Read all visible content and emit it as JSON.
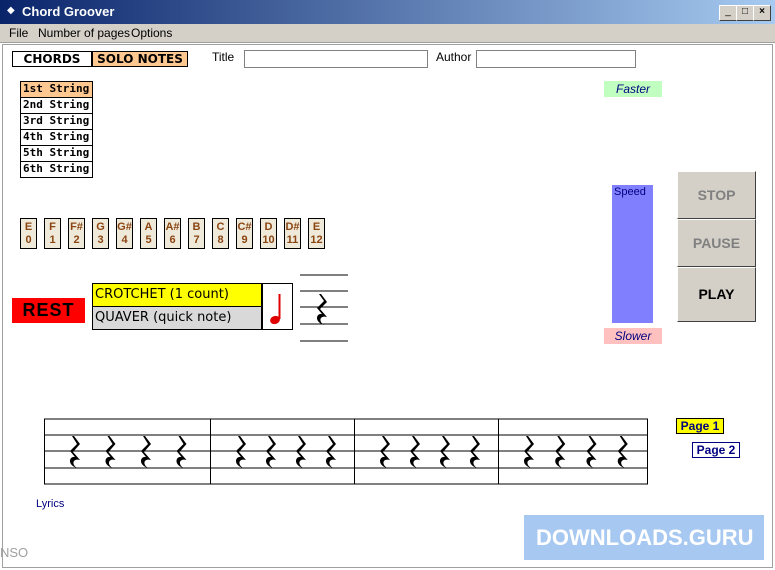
{
  "window": {
    "title": "Chord Groover",
    "app_icon": "◆",
    "minimize": "_",
    "maximize": "□",
    "close": "×"
  },
  "menu": [
    "File",
    "Number of pages",
    "Options"
  ],
  "tabs": {
    "chords": "CHORDS",
    "solo_notes": "SOLO NOTES"
  },
  "fields": {
    "title_label": "Title",
    "title_value": "",
    "author_label": "Author",
    "author_value": ""
  },
  "strings": [
    "1st String",
    "2nd String",
    "3rd String",
    "4th String",
    "5th String",
    "6th String"
  ],
  "selected_string": "1st String",
  "frets": [
    {
      "note": "E",
      "num": "0"
    },
    {
      "note": "F",
      "num": "1"
    },
    {
      "note": "F#",
      "num": "2"
    },
    {
      "note": "G",
      "num": "3"
    },
    {
      "note": "G#",
      "num": "4"
    },
    {
      "note": "A",
      "num": "5"
    },
    {
      "note": "A#",
      "num": "6"
    },
    {
      "note": "B",
      "num": "7"
    },
    {
      "note": "C",
      "num": "8"
    },
    {
      "note": "C#",
      "num": "9"
    },
    {
      "note": "D",
      "num": "10"
    },
    {
      "note": "D#",
      "num": "11"
    },
    {
      "note": "E",
      "num": "12"
    }
  ],
  "rest_label": "REST",
  "note_lengths": {
    "crotchet": "CROTCHET (1 count)",
    "quaver": "QUAVER (quick note)"
  },
  "speed": {
    "faster": "Faster",
    "label": "Speed",
    "slower": "Slower"
  },
  "controls": {
    "stop": "STOP",
    "pause": "PAUSE",
    "play": "PLAY"
  },
  "pages": {
    "page1": "Page 1",
    "page2": "Page 2"
  },
  "lyrics_label": "Lyrics",
  "corner_text": "NSO",
  "watermark": "DOWNLOADS.GURU",
  "colors": {
    "selected_string": "#ffc890",
    "solo_tab": "#ffc890",
    "crotchet_bg": "#ffff00",
    "quaver_bg": "#d9d9d9",
    "rest_bg": "#ff0000",
    "speed_bar": "#8080ff",
    "faster_bg": "#c0ffc0",
    "slower_bg": "#ffc0c0",
    "page1_bg": "#ffff00",
    "page_text": "#000080"
  }
}
